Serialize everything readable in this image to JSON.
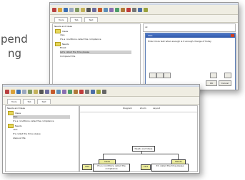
{
  "side_text": {
    "line1": "pend",
    "line2": "ng"
  },
  "back_window": {
    "tabs": [
      "Tools",
      "Tab",
      "Text"
    ],
    "tree_heading": "Needs and Ideas",
    "tree": [
      {
        "label": "Ideas",
        "folder": true,
        "selected": false
      },
      {
        "label": "idea",
        "folder": false,
        "selected": false
      },
      {
        "label": "It's a conditions called the compliance",
        "folder": false,
        "selected": false
      },
      {
        "label": "Needs",
        "folder": true,
        "selected": false
      },
      {
        "label": "Break",
        "folder": false,
        "selected": false
      },
      {
        "label": "Let's called the time please",
        "folder": false,
        "selected": true
      },
      {
        "label": "Compared the",
        "folder": false,
        "selected": false
      }
    ],
    "field_value": "ok",
    "dialog": {
      "title": "Idea",
      "text": "Enter more text when enough is it enough change of today"
    },
    "buttons": {
      "ok": "OK",
      "cancel": "Cancel"
    }
  },
  "front_window": {
    "tabs": [
      "Tools",
      "Tab",
      "Text"
    ],
    "tree_heading": "Needs and Ideas",
    "tree": [
      {
        "label": "Ideas",
        "folder": true,
        "selected": false
      },
      {
        "label": "idea",
        "folder": false,
        "selected": true
      },
      {
        "label": "It's a conditions called the compliance",
        "folder": false,
        "selected": false
      },
      {
        "label": "Needs",
        "folder": true,
        "selected": false
      },
      {
        "label": "care",
        "folder": false,
        "selected": false
      },
      {
        "label": "It's called the time please",
        "folder": false,
        "selected": false
      },
      {
        "label": "steps at life",
        "folder": false,
        "selected": false
      }
    ],
    "header_labels": [
      "Diagram",
      "Zoom",
      "Layout"
    ],
    "diagram": {
      "root": "Needs and Ideas",
      "branch_left": "Ideas",
      "branch_right": "Needs",
      "leaf_left_small": "idea",
      "leaf_left_text": "It's a conditions called the compliance",
      "leaf_right_small": "care",
      "leaf_right_text": "It's called the time please"
    }
  }
}
